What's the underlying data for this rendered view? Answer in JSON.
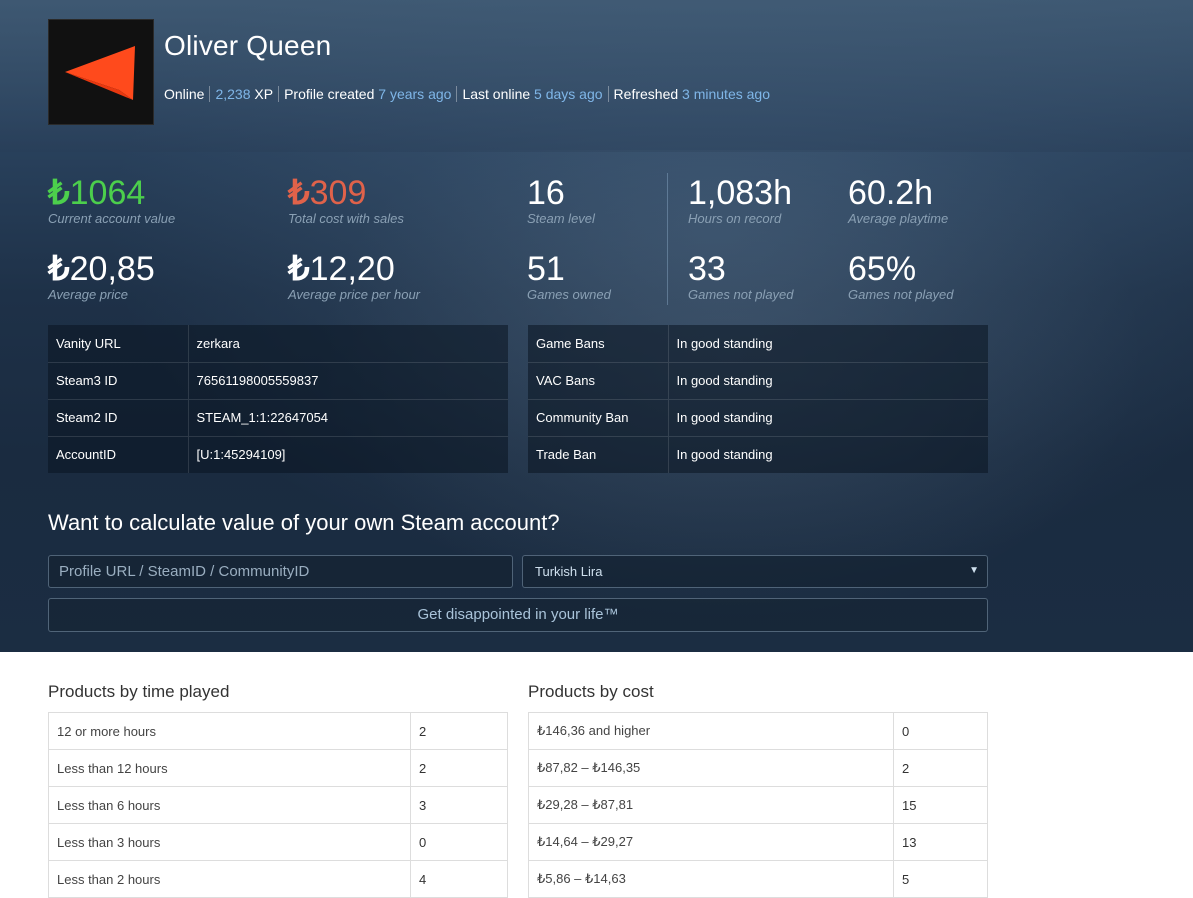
{
  "profile": {
    "name": "Oliver Queen",
    "status": "Online",
    "xp_value": "2,238",
    "xp_unit": " XP",
    "created_label": "Profile created ",
    "created_value": "7 years ago",
    "last_online_label": "Last online ",
    "last_online_value": "5 days ago",
    "refreshed_label": "Refreshed ",
    "refreshed_value": "3 minutes ago",
    "avatar_icon": "orange-chevron-logo",
    "avatar_color": "#ff4a1c"
  },
  "currency_symbol": "₺",
  "stats": {
    "account_value": {
      "value": "1064",
      "label": "Current account value"
    },
    "total_cost": {
      "value": "309",
      "label": "Total cost with sales"
    },
    "steam_level": {
      "value": "16",
      "label": "Steam level"
    },
    "hours_on_record": {
      "value": "1,083h",
      "label": "Hours on record"
    },
    "avg_playtime": {
      "value": "60.2h",
      "label": "Average playtime"
    },
    "avg_price": {
      "value": "20,85",
      "label": "Average price"
    },
    "avg_price_hour": {
      "value": "12,20",
      "label": "Average price per hour"
    },
    "games_owned": {
      "value": "51",
      "label": "Games owned"
    },
    "games_not_played": {
      "value": "33",
      "label": "Games not played"
    },
    "games_not_played_pct": {
      "value": "65%",
      "label": "Games not played"
    }
  },
  "colors": {
    "value_green": "#4ccf4c",
    "cost_red": "#e0624a",
    "link_blue": "#7fb6e8"
  },
  "ids": [
    {
      "key": "Vanity URL",
      "value": "zerkara"
    },
    {
      "key": "Steam3 ID",
      "value": "76561198005559837"
    },
    {
      "key": "Steam2 ID",
      "value": "STEAM_1:1:22647054"
    },
    {
      "key": "AccountID",
      "value": "[U:1:45294109]"
    }
  ],
  "bans": [
    {
      "key": "Game Bans",
      "value": "In good standing"
    },
    {
      "key": "VAC Bans",
      "value": "In good standing"
    },
    {
      "key": "Community Ban",
      "value": "In good standing"
    },
    {
      "key": "Trade Ban",
      "value": "In good standing"
    }
  ],
  "calculator": {
    "title": "Want to calculate value of your own Steam account?",
    "input_placeholder": "Profile URL / SteamID / CommunityID",
    "currency_selected": "Turkish Lira",
    "submit_label": "Get disappointed in your life™"
  },
  "time_played": {
    "title": "Products by time played",
    "rows": [
      {
        "label": "12 or more hours",
        "count": "2"
      },
      {
        "label": "Less than 12 hours",
        "count": "2"
      },
      {
        "label": "Less than 6 hours",
        "count": "3"
      },
      {
        "label": "Less than 3 hours",
        "count": "0"
      },
      {
        "label": "Less than 2 hours",
        "count": "4"
      }
    ]
  },
  "by_cost": {
    "title": "Products by cost",
    "rows": [
      {
        "label": "₺146,36 and higher",
        "count": "0"
      },
      {
        "label": "₺87,82 – ₺146,35",
        "count": "2"
      },
      {
        "label": "₺29,28 – ₺87,81",
        "count": "15"
      },
      {
        "label": "₺14,64 – ₺29,27",
        "count": "13"
      },
      {
        "label": "₺5,86 – ₺14,63",
        "count": "5"
      }
    ]
  }
}
